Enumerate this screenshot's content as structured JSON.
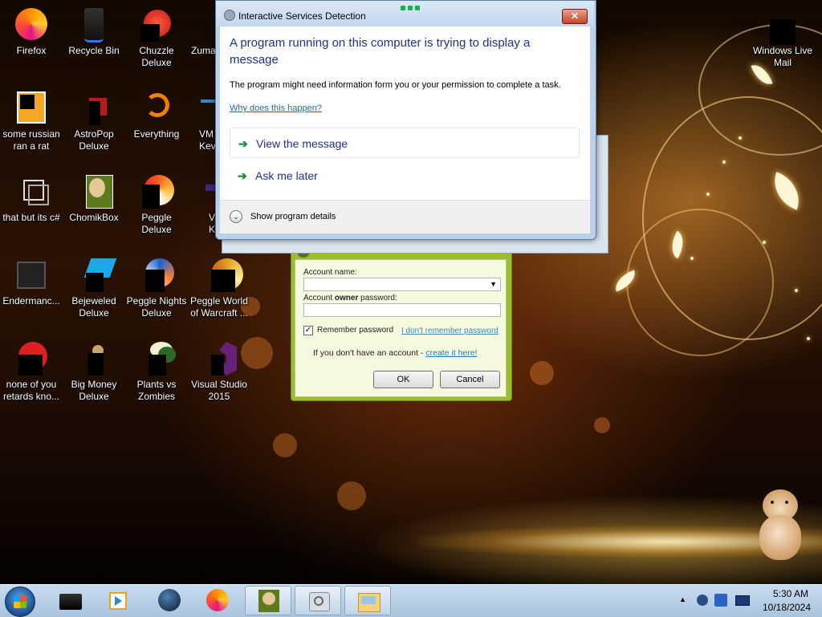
{
  "desktop": {
    "icons": [
      {
        "label": "Firefox"
      },
      {
        "label": "Recycle Bin"
      },
      {
        "label": "Chuzzle\nDeluxe"
      },
      {
        "label": "Zuma"
      },
      {
        "label": "Windows Live\nMail"
      },
      {
        "label": "some russian\nran a rat"
      },
      {
        "label": "AstroPop\nDeluxe"
      },
      {
        "label": "Everything"
      },
      {
        "label": "VM\nKev"
      },
      {
        "label": "that but its c#"
      },
      {
        "label": "ChomikBox"
      },
      {
        "label": "Peggle Deluxe"
      },
      {
        "label": "V\nKev"
      },
      {
        "label": "Endermanc..."
      },
      {
        "label": "Bejeweled\nDeluxe"
      },
      {
        "label": "Peggle Nights\nDeluxe"
      },
      {
        "label": "Peggle World\nof Warcraft ..."
      },
      {
        "label": "none of you\nretards kno..."
      },
      {
        "label": "Big Money\nDeluxe"
      },
      {
        "label": "Plants vs\nZombies"
      },
      {
        "label": "Visual Studio\n2015"
      }
    ]
  },
  "isd_dialog": {
    "title": "Interactive Services Detection",
    "close_label": "✕",
    "headline": "A program running on this computer is trying to display a message",
    "description": "The program might need information form you or your permission to complete a task.",
    "why_link": "Why does this happen?",
    "options": [
      {
        "label": "View the message",
        "icon": "green-arrow-icon"
      },
      {
        "label": "Ask me later",
        "icon": "green-arrow-icon"
      }
    ],
    "details_label": "Show program details",
    "details_icon": "chevron-down-icon"
  },
  "account_dialog": {
    "account_name_label": "Account name:",
    "password_label_prefix": "Account ",
    "password_label_bold": "owner",
    "password_label_suffix": " password:",
    "remember_label": "Remember password",
    "remember_checked": true,
    "forgot_link": "I don't remember password",
    "signup_prefix": "If you don't have an account - ",
    "signup_link": "create it here!",
    "ok_label": "OK",
    "cancel_label": "Cancel",
    "accent_color": "#9bbe2f"
  },
  "taskbar": {
    "items": [
      {
        "icon": "start-orb-icon"
      },
      {
        "icon": "black-box-icon"
      },
      {
        "icon": "media-player-icon"
      },
      {
        "icon": "globe-icon"
      },
      {
        "icon": "firefox-icon"
      },
      {
        "icon": "chomikbox-icon",
        "active": true
      },
      {
        "icon": "settings-app-icon",
        "active": true
      },
      {
        "icon": "folder-window-icon",
        "active": true
      }
    ],
    "clock_time": "5:30 AM",
    "clock_date": "10/18/2024"
  }
}
